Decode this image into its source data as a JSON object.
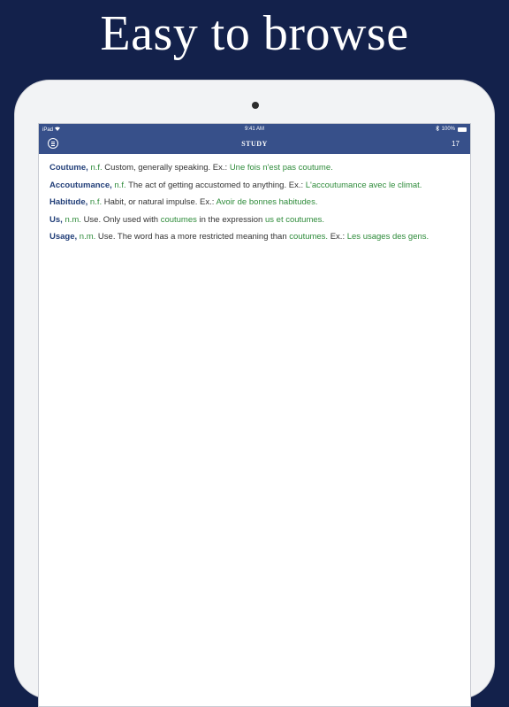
{
  "headline": "Easy to browse",
  "status_bar": {
    "device": "iPad",
    "time": "9:41 AM",
    "battery": "100%"
  },
  "nav": {
    "title": "STUDY",
    "count": "17"
  },
  "entries": [
    {
      "term": "Coutume,",
      "pos": "n.f.",
      "def": "Custom, generally speaking. Ex.:",
      "example": "Une fois n'est pas coutume."
    },
    {
      "term": "Accoutumance,",
      "pos": "n.f.",
      "def": "The act of getting accustomed to anything. Ex.:",
      "example": "L'accoutumance avec le climat."
    },
    {
      "term": "Habitude,",
      "pos": "n.f.",
      "def": "Habit, or natural impulse. Ex.:",
      "example": "Avoir de bonnes habitudes."
    },
    {
      "term": "Us,",
      "pos": "n.m.",
      "def_a": "Use. Only used with",
      "ref": "coutumes",
      "def_b": "in the expression",
      "example": "us et coutumes."
    },
    {
      "term": "Usage,",
      "pos": "n.m.",
      "def_a": "Use. The word has a more restricted meaning than",
      "ref": "coutumes.",
      "def_b": "Ex.:",
      "example": "Les usages des gens."
    }
  ],
  "icons": {
    "menu": "menu-circle-icon",
    "wifi": "wifi-icon",
    "bluetooth": "bluetooth-icon",
    "battery": "battery-icon"
  },
  "colors": {
    "background": "#13214b",
    "nav_bar": "#37508a",
    "term": "#213e78",
    "green": "#2e8b3a"
  }
}
